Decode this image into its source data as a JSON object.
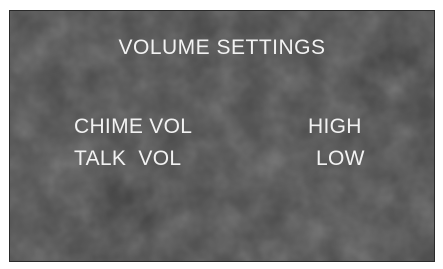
{
  "screen": {
    "title": "VOLUME SETTINGS",
    "settings": [
      {
        "label": "CHIME VOL",
        "value": "HIGH"
      },
      {
        "label": "TALK  VOL",
        "value": "LOW"
      }
    ]
  },
  "colors": {
    "background": "#4a4a4a",
    "text": "#f2f2f2",
    "border": "#2a2a2a"
  }
}
